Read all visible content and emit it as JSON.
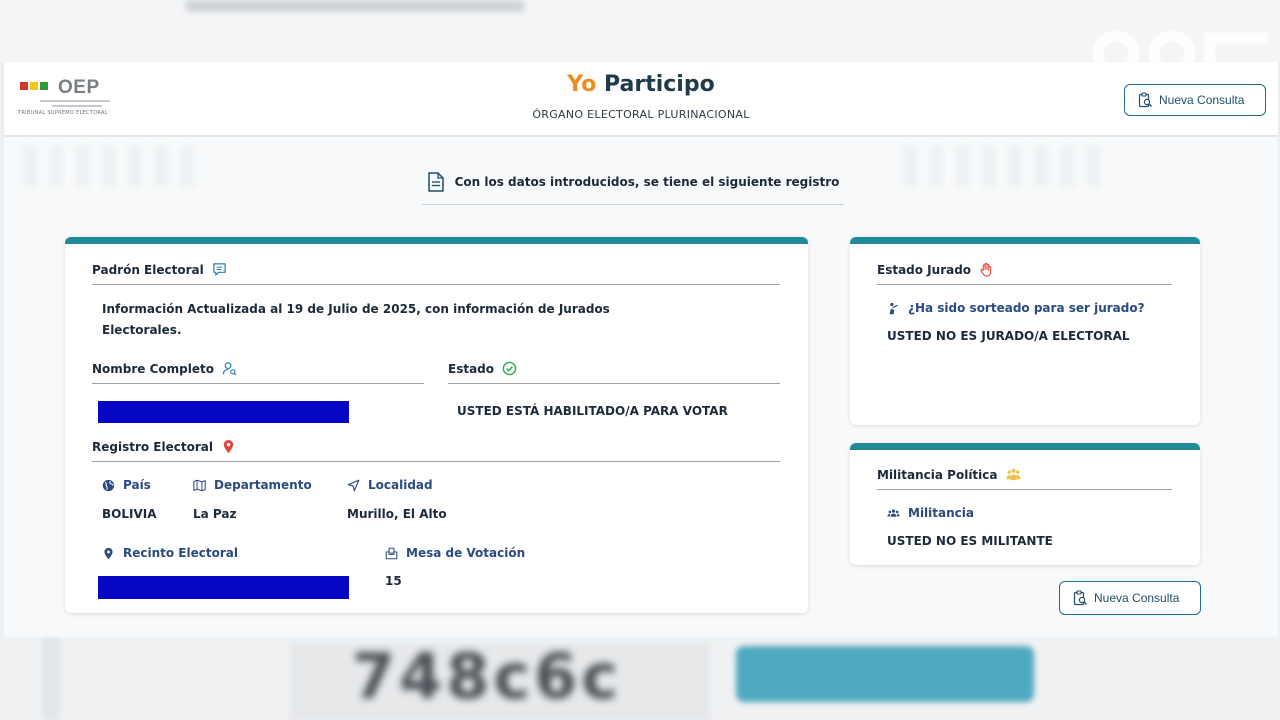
{
  "header": {
    "logo_text": "OEP",
    "logo_subtext": "TRIBUNAL SUPREMO ELECTORAL",
    "title_yo": "Yo",
    "title_rest": " Participo",
    "subtitle": "ÓRGANO ELECTORAL PLURINACIONAL",
    "new_query_label": "Nueva Consulta"
  },
  "notice": {
    "text": "Con los datos introducidos, se tiene el siguiente registro"
  },
  "padron": {
    "title": "Padrón Electoral",
    "info": "Información Actualizada al 19 de Julio de 2025, con información de Jurados",
    "info_line2": "Electorales.",
    "nombre_label": "Nombre Completo",
    "estado_label": "Estado",
    "estado_value": "USTED ESTÁ HABILITADO/A PARA VOTAR",
    "registro_title": "Registro Electoral",
    "pais_label": "País",
    "pais_value": "BOLIVIA",
    "departamento_label": "Departamento",
    "departamento_value": "La Paz",
    "localidad_label": "Localidad",
    "localidad_value": "Murillo, El Alto",
    "recinto_label": "Recinto Electoral",
    "mesa_label": "Mesa de Votación",
    "mesa_value": "15"
  },
  "jurado": {
    "title": "Estado Jurado",
    "question": "¿Ha sido sorteado para ser jurado?",
    "value": "USTED NO ES JURADO/A ELECTORAL"
  },
  "militancia": {
    "title": "Militancia Política",
    "label": "Militancia",
    "value": "USTED NO ES MILITANTE"
  },
  "actions": {
    "new_query_label": "Nueva Consulta"
  },
  "captcha": {
    "text": "748c6c"
  },
  "colors": {
    "accent": "#1f8a98",
    "brand_orange": "#f08a1c",
    "redaction": "#0606c4",
    "label_blue": "#2b4a80"
  }
}
